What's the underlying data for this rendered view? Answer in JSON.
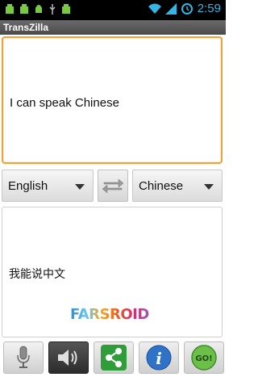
{
  "status_bar": {
    "time": "2:59",
    "icons": [
      "android-notification-icon",
      "android-notification-icon",
      "android-notification-icon",
      "usb-icon",
      "android-notification-icon",
      "wifi-icon",
      "signal-icon",
      "sync-icon"
    ]
  },
  "app": {
    "title": "TransZilla"
  },
  "source": {
    "text": "I can speak Chinese"
  },
  "languages": {
    "source_lang": "English",
    "target_lang": "Chinese",
    "swap_icon": "swap-arrows-icon"
  },
  "target": {
    "text": "我能说中文"
  },
  "watermark": {
    "text": "FARSROID"
  },
  "toolbar": {
    "buttons": [
      "microphone-icon",
      "speaker-icon",
      "share-icon",
      "info-icon",
      "go-icon"
    ],
    "go_label": "GO!",
    "info_label": "i"
  },
  "colors": {
    "accent_blue": "#33b5e5",
    "focus_orange": "#f0a23a",
    "share_green": "#2e9d3a"
  }
}
